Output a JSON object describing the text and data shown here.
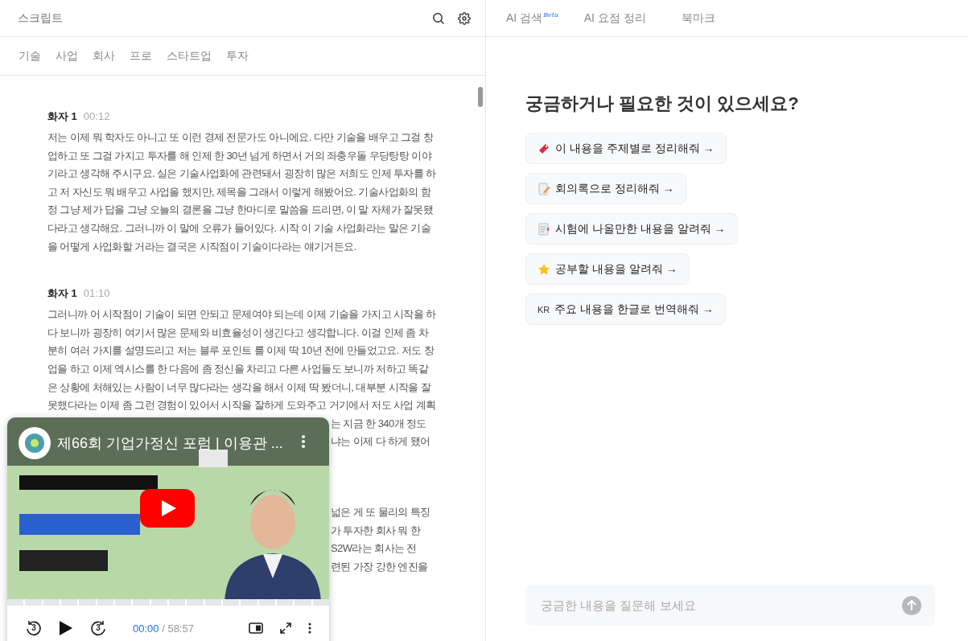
{
  "left_panel": {
    "title": "스크립트",
    "keywords": [
      "기술",
      "사업",
      "회사",
      "프로",
      "스타트업",
      "투자"
    ],
    "transcript": [
      {
        "speaker": "화자 1",
        "time": "00:12",
        "text": "저는 이제 뭐 학자도 아니고 또 이런 경제 전문가도 아니에요. 다만 기술을 배우고 그걸 창\n업하고 또 그걸 가지고 투자를 해 인제 한 30년 넘게 하면서 거의 좌충우돌 우당탕탕 이야\n기라고 생각해 주시구요. 실은 기술사업화에 관련돼서 굉장히 많은 저희도 인제 투자를 하\n고 저 자신도 뭐 배우고 사업을 했지만, 제목을 그래서 이렇게 해봤어요. 기술사업화의 함\n정 그냥 제가 답을 그냥 오늘의 결론을 그냥 한마디로 말씀을 드리면, 이 말 자체가 잘못됐\n다라고 생각해요. 그러니까 이 말에 오류가 들어있다. 시작 이 기술 사업화라는 말은 기술\n을 어떻게 사업화할 거라는 결국은 시작점이 기술이다라는 얘기거든요."
      },
      {
        "speaker": "화자 1",
        "time": "01:10",
        "text": "그러니까 어 시작점이 기술이 되면 안되고 문제여야 되는데 이제 기술을 가지고 시작을 하\n다 보니까 굉장히 여기서 많은 문제와 비효율성이 생긴다고 생각합니다. 이걸 인제 좀 차\n분히 여러 가지를 설명드리고 저는 블루 포인트 를 이제 딱 10년 전에 만들었고요. 저도 창\n업을 하고 이제 엑시스를 한 다음에 좀 정신을 차리고 다른 사업들도 보니까 저하고 똑같\n은 상황에 처해있는 사람이 너무 많다라는 생각을 해서 이제 딱 봤더니, 대부분 시작을 잘\n못했다라는 이제 좀 그런 경험이 있어서 시작을 잘하게 도와주고 거기에서 저도 사업 계획",
        "partial_lines": [
          "는 지금 한 340개 정도",
          "냐는 이제 다 하게 됐어"
        ]
      },
      {
        "partial_lines": [
          "넓은 게 또 물리의 특징",
          "가 투자한 회사 뭐 한",
          "S2W라는 회사는 전",
          "련된 가장 강한 엔진을"
        ]
      }
    ]
  },
  "player": {
    "title": "제66회 기업가정신 포럼 | 이용관 ...",
    "controls": [
      {
        "kind": "rewind",
        "label": "3"
      },
      {
        "kind": "play"
      },
      {
        "kind": "forward",
        "label": "3"
      }
    ],
    "level": 0,
    "current_time": "00:00",
    "duration": "/ 58:57"
  },
  "right_panel": {
    "tabs": [
      {
        "label": "AI 검색",
        "badge": "Beta"
      },
      {
        "label": "AI 요점 정리"
      },
      {
        "label": "북마크"
      }
    ],
    "heading": "궁금하거나 필요한 것이 있으세요?",
    "suggestions": [
      {
        "kind": "ticket",
        "label": "이 내용을 주제별로 정리해줘 →"
      },
      {
        "kind": "memo",
        "label": "회의록으로 정리해줘 →"
      },
      {
        "kind": "document",
        "label": "시험에 나올만한 내용을 알려줘 →"
      },
      {
        "kind": "star",
        "label": "공부할 내용을 알려줘 →"
      },
      {
        "kind": "code",
        "code": "KR",
        "label": "주요 내용을 한글로 번역해줘 →"
      }
    ],
    "question": {
      "placeholder": "궁금한 내용을 질문해 보세요"
    }
  }
}
